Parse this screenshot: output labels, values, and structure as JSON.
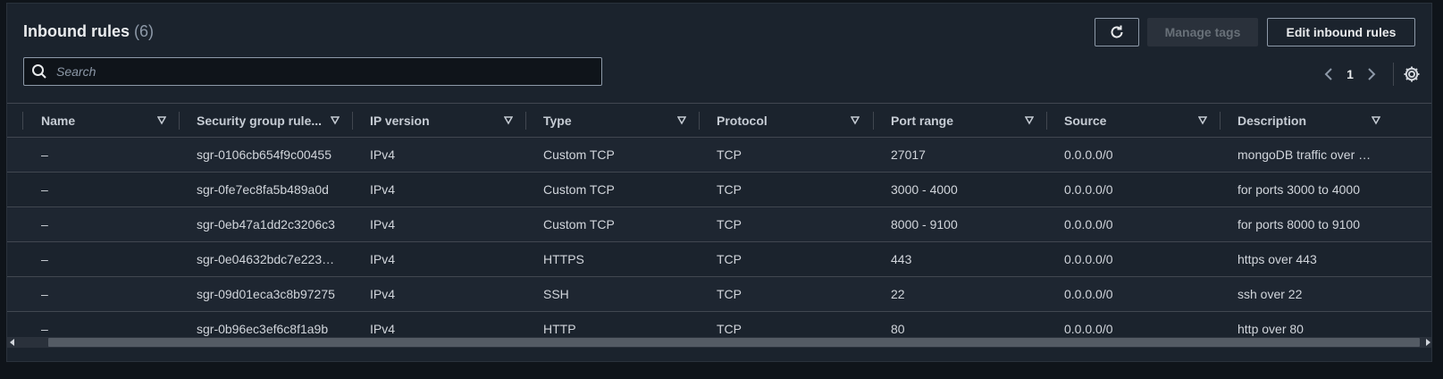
{
  "header": {
    "title": "Inbound rules",
    "count": "(6)",
    "manage_tags_label": "Manage tags",
    "edit_label": "Edit inbound rules"
  },
  "search": {
    "placeholder": "Search"
  },
  "pagination": {
    "current_page": "1"
  },
  "table": {
    "columns": [
      "Name",
      "Security group rule...",
      "IP version",
      "Type",
      "Protocol",
      "Port range",
      "Source",
      "Description"
    ],
    "rows": [
      [
        "–",
        "sgr-0106cb654f9c00455",
        "IPv4",
        "Custom TCP",
        "TCP",
        "27017",
        "0.0.0.0/0",
        "mongoDB traffic over …"
      ],
      [
        "–",
        "sgr-0fe7ec8fa5b489a0d",
        "IPv4",
        "Custom TCP",
        "TCP",
        "3000 - 4000",
        "0.0.0.0/0",
        "for ports 3000 to 4000"
      ],
      [
        "–",
        "sgr-0eb47a1dd2c3206c3",
        "IPv4",
        "Custom TCP",
        "TCP",
        "8000 - 9100",
        "0.0.0.0/0",
        "for ports 8000 to 9100"
      ],
      [
        "–",
        "sgr-0e04632bdc7e223…",
        "IPv4",
        "HTTPS",
        "TCP",
        "443",
        "0.0.0.0/0",
        "https over 443"
      ],
      [
        "–",
        "sgr-09d01eca3c8b97275",
        "IPv4",
        "SSH",
        "TCP",
        "22",
        "0.0.0.0/0",
        "ssh over 22"
      ],
      [
        "–",
        "sgr-0b96ec3ef6c8f1a9b",
        "IPv4",
        "HTTP",
        "TCP",
        "80",
        "0.0.0.0/0",
        "http over 80"
      ]
    ]
  }
}
